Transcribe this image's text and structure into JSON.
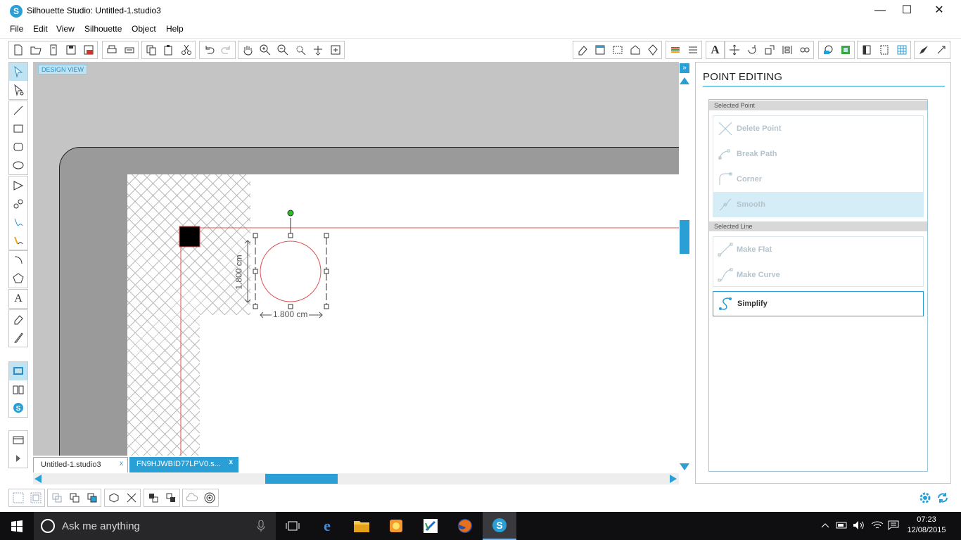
{
  "window": {
    "title": "Silhouette Studio: Untitled-1.studio3",
    "logo_letter": "S",
    "minimize": "—",
    "maximize": "☐",
    "close": "✕"
  },
  "menu": [
    "File",
    "Edit",
    "View",
    "Silhouette",
    "Object",
    "Help"
  ],
  "canvas": {
    "view_label": "DESIGN VIEW",
    "width_dimension": "1.800 cm",
    "height_dimension": "1.800 cm"
  },
  "doc_tabs": [
    {
      "label": "Untitled-1.studio3",
      "close": "x",
      "active": true
    },
    {
      "label": "FN9HJWBID77LPV0.s...",
      "close": "x",
      "active": false
    }
  ],
  "panel": {
    "title": "POINT EDITING",
    "selected_point_header": "Selected Point",
    "selected_line_header": "Selected Line",
    "items": {
      "delete_point": "Delete Point",
      "break_path": "Break Path",
      "corner": "Corner",
      "smooth": "Smooth",
      "make_flat": "Make Flat",
      "make_curve": "Make Curve",
      "simplify": "Simplify"
    }
  },
  "taskbar": {
    "search_placeholder": "Ask me anything",
    "time": "07:23",
    "date": "12/08/2015"
  },
  "colors": {
    "accent": "#2a9fd6",
    "selection_light": "#d4edf7",
    "cut_line": "#e05050",
    "rotate_handle": "#22c022"
  }
}
